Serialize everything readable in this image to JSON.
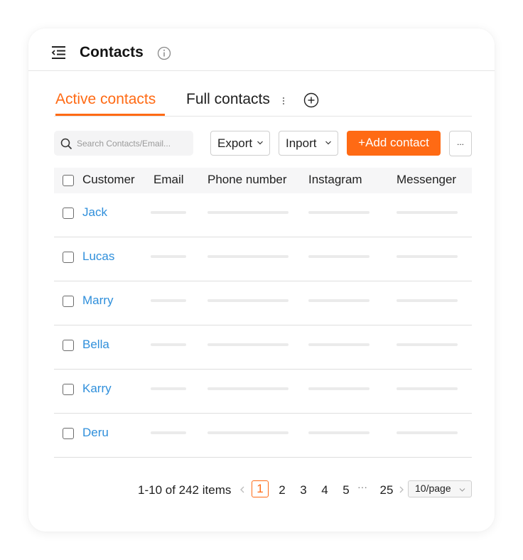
{
  "header": {
    "title": "Contacts"
  },
  "tabs": [
    {
      "label": "Active contacts",
      "active": true
    },
    {
      "label": "Full contacts",
      "active": false
    }
  ],
  "toolbar": {
    "search_placeholder": "Search Contacts/Email...",
    "export_label": "Export",
    "import_label": "Inport",
    "add_label": "+Add contact",
    "more_label": "..."
  },
  "table": {
    "columns": [
      "Customer",
      "Email",
      "Phone number",
      "Instagram",
      "Messenger"
    ],
    "rows": [
      {
        "customer": "Jack"
      },
      {
        "customer": "Lucas"
      },
      {
        "customer": "Marry"
      },
      {
        "customer": "Bella"
      },
      {
        "customer": "Karry"
      },
      {
        "customer": "Deru"
      }
    ]
  },
  "pagination": {
    "total_text": "1-10 of 242 items",
    "current": "1",
    "pages": [
      "2",
      "3",
      "4",
      "5"
    ],
    "ellipsis": "···",
    "last": "25",
    "page_size": "10/page"
  },
  "colors": {
    "accent": "#ff6a14",
    "link": "#2f8fdb",
    "placeholder_bar": "#ebebeb"
  }
}
